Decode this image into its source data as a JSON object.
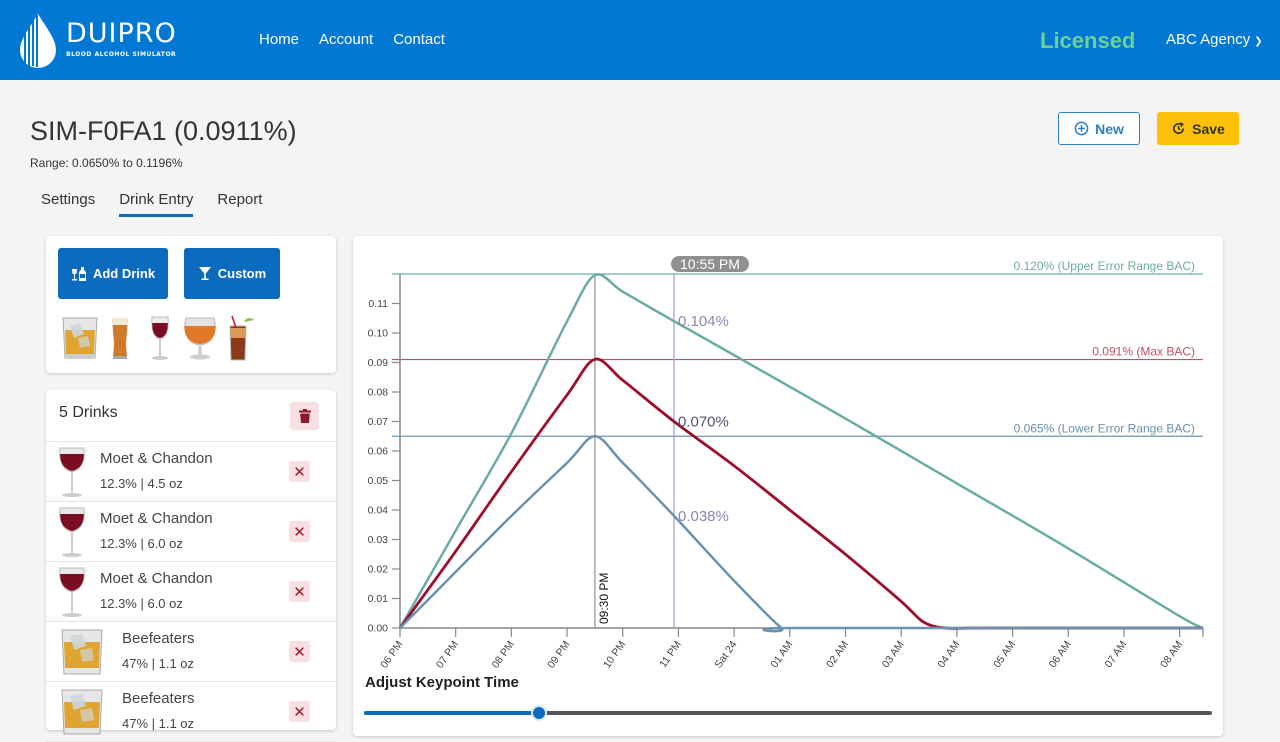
{
  "navbar": {
    "brand_name": "DUIPRO",
    "brand_tagline": "BLOOD ALCOHOL SIMULATOR",
    "links": [
      {
        "label": "Home"
      },
      {
        "label": "Account"
      },
      {
        "label": "Contact"
      }
    ],
    "license_status": "Licensed",
    "account_name": "ABC Agency",
    "colors": {
      "bar": "#0078d4",
      "licensed": "#6fcf97"
    }
  },
  "simulation": {
    "title": "SIM-F0FA1 (0.0911%)",
    "range_text": "Range: 0.0650% to 0.1196%"
  },
  "tabs": [
    {
      "label": "Settings",
      "active": false
    },
    {
      "label": "Drink Entry",
      "active": true
    },
    {
      "label": "Report",
      "active": false
    }
  ],
  "actions": {
    "new_label": "New",
    "save_label": "Save"
  },
  "add_panel": {
    "add_drink_label": "Add Drink",
    "custom_label": "Custom",
    "quick_drinks": [
      "whiskey-glass",
      "beer-pint",
      "red-wine-glass",
      "snifter-ale",
      "cocktail-highball"
    ]
  },
  "drink_list": {
    "count_label": "5 Drinks",
    "items": [
      {
        "name": "Moet & Chandon",
        "info": "12.3% | 4.5 oz",
        "icon": "wine-glass"
      },
      {
        "name": "Moet & Chandon",
        "info": "12.3% | 6.0 oz",
        "icon": "wine-glass"
      },
      {
        "name": "Moet & Chandon",
        "info": "12.3% | 6.0 oz",
        "icon": "wine-glass"
      },
      {
        "name": "Beefeaters",
        "info": "47% | 1.1 oz",
        "icon": "rocks-glass"
      },
      {
        "name": "Beefeaters",
        "info": "47% | 1.1 oz",
        "icon": "rocks-glass"
      }
    ]
  },
  "slider": {
    "label": "Adjust Keypoint Time",
    "value_fraction": 0.206
  },
  "chart_data": {
    "type": "line",
    "xlabel": "",
    "ylabel": "",
    "x_unit": "hours since 06 PM",
    "xlim": [
      0,
      14.42
    ],
    "ylim": [
      0,
      0.12
    ],
    "yticks": [
      0.0,
      0.01,
      0.02,
      0.03,
      0.04,
      0.05,
      0.06,
      0.07,
      0.08,
      0.09,
      0.1,
      0.11
    ],
    "ytick_labels": [
      "0.00",
      "0.01",
      "0.02",
      "0.03",
      "0.04",
      "0.05",
      "0.06",
      "0.07",
      "0.08",
      "0.09",
      "0.10",
      "0.11"
    ],
    "xticks": [
      0,
      1,
      2,
      3,
      4,
      5,
      6,
      7,
      8,
      9,
      10,
      11,
      12,
      13,
      14
    ],
    "xtick_labels": [
      "06 PM",
      "07 PM",
      "08 PM",
      "09 PM",
      "10 PM",
      "11 PM",
      "Sat 24",
      "01 AM",
      "02 AM",
      "03 AM",
      "04 AM",
      "05 AM",
      "06 AM",
      "07 AM",
      "08 AM"
    ],
    "series": [
      {
        "name": "Upper Error Range BAC",
        "color": "#6aaba6",
        "x": [
          0,
          1.0,
          2.0,
          3.0,
          3.5,
          4.0,
          4.92,
          6.0,
          8.0,
          10.0,
          12.0,
          14.0,
          14.42
        ],
        "y": [
          0,
          0.033,
          0.066,
          0.104,
          0.1196,
          0.114,
          0.104,
          0.0925,
          0.071,
          0.049,
          0.027,
          0.004,
          0
        ]
      },
      {
        "name": "Max BAC",
        "color": "#9b0e2c",
        "x": [
          0,
          1.0,
          2.0,
          3.0,
          3.5,
          4.0,
          4.92,
          6.0,
          7.0,
          8.0,
          9.0,
          9.4,
          9.8,
          10.5,
          14.42
        ],
        "y": [
          0,
          0.026,
          0.053,
          0.079,
          0.0911,
          0.084,
          0.07,
          0.055,
          0.04,
          0.025,
          0.009,
          0.002,
          0,
          0,
          0
        ]
      },
      {
        "name": "Lower Error Range BAC",
        "color": "#6a92ae",
        "x": [
          0,
          1.0,
          2.0,
          3.0,
          3.5,
          4.0,
          4.92,
          6.0,
          6.85,
          7.05,
          14.42
        ],
        "y": [
          0,
          0.019,
          0.038,
          0.056,
          0.065,
          0.056,
          0.038,
          0.016,
          0,
          0,
          0
        ]
      }
    ],
    "reference_lines": [
      {
        "value": 0.12,
        "label": "0.120% (Upper Error Range BAC)",
        "color": "#6aaba6"
      },
      {
        "value": 0.091,
        "label": "0.091% (Max BAC)",
        "color": "#c0506a"
      },
      {
        "value": 0.065,
        "label": "0.065% (Lower Error Range BAC)",
        "color": "#6a92ae"
      }
    ],
    "peak_marker": {
      "x": 3.5,
      "label": "09:30 PM"
    },
    "keypoint": {
      "x": 4.92,
      "time_label": "10:55 PM",
      "values": [
        {
          "series": "Upper Error Range BAC",
          "label": "0.104%",
          "value": 0.104
        },
        {
          "series": "Max BAC",
          "label": "0.070%",
          "value": 0.07
        },
        {
          "series": "Lower Error Range BAC",
          "label": "0.038%",
          "value": 0.038
        }
      ]
    }
  }
}
